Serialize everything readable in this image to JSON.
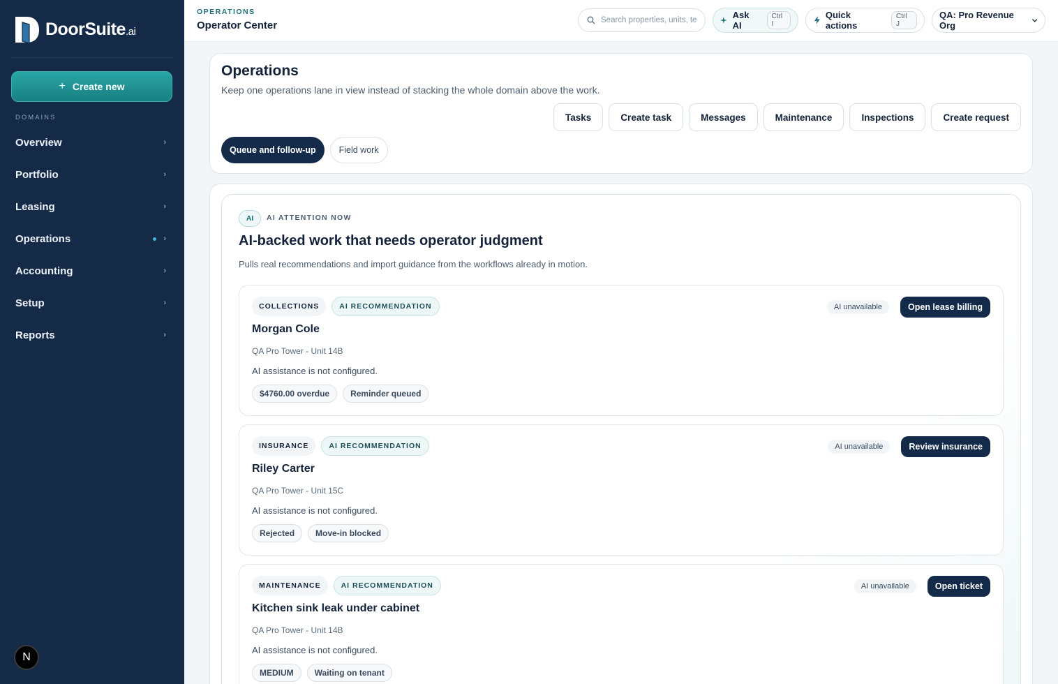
{
  "brand": {
    "name": "DoorSuite",
    "suffix": ".ai"
  },
  "sidebar": {
    "create_label": "Create new",
    "domains_label": "DOMAINS",
    "items": [
      {
        "label": "Overview"
      },
      {
        "label": "Portfolio"
      },
      {
        "label": "Leasing"
      },
      {
        "label": "Operations",
        "active": true
      },
      {
        "label": "Accounting"
      },
      {
        "label": "Setup"
      },
      {
        "label": "Reports"
      }
    ],
    "badge": "N"
  },
  "header": {
    "kicker": "OPERATIONS",
    "title": "Operator Center",
    "search_placeholder": "Search properties, units, te",
    "ask_ai": {
      "label": "Ask AI",
      "shortcut": "Ctrl I"
    },
    "quick_actions": {
      "label": "Quick actions",
      "shortcut": "Ctrl J"
    },
    "org": "QA: Pro Revenue Org"
  },
  "ops": {
    "title": "Operations",
    "subtitle": "Keep one operations lane in view instead of stacking the whole domain above the work.",
    "actions": [
      "Tasks",
      "Create task",
      "Messages",
      "Maintenance",
      "Inspections",
      "Create request"
    ],
    "lanes": [
      {
        "label": "Queue and follow-up",
        "active": true
      },
      {
        "label": "Field work",
        "active": false
      }
    ]
  },
  "attention": {
    "chip": "AI",
    "kicker": "AI ATTENTION NOW",
    "title": "AI-backed work that needs operator judgment",
    "subtitle": "Pulls real recommendations and import guidance from the workflows already in motion.",
    "items": [
      {
        "category": "COLLECTIONS",
        "ai_tag": "AI RECOMMENDATION",
        "name": "Morgan Cole",
        "location": "QA Pro Tower - Unit 14B",
        "note": "AI assistance is not configured.",
        "chips": [
          "$4760.00 overdue",
          "Reminder queued"
        ],
        "status": "AI unavailable",
        "action": "Open lease billing"
      },
      {
        "category": "INSURANCE",
        "ai_tag": "AI RECOMMENDATION",
        "name": "Riley Carter",
        "location": "QA Pro Tower - Unit 15C",
        "note": "AI assistance is not configured.",
        "chips": [
          "Rejected",
          "Move-in blocked"
        ],
        "status": "AI unavailable",
        "action": "Review insurance"
      },
      {
        "category": "MAINTENANCE",
        "ai_tag": "AI RECOMMENDATION",
        "name": "Kitchen sink leak under cabinet",
        "location": "QA Pro Tower - Unit 14B",
        "note": "AI assistance is not configured.",
        "chips": [
          "MEDIUM",
          "Waiting on tenant"
        ],
        "status": "AI unavailable",
        "action": "Open ticket"
      }
    ]
  },
  "colors": {
    "sidebar": "#142a47",
    "accent": "#1d6f78",
    "primary": "#132a48"
  }
}
